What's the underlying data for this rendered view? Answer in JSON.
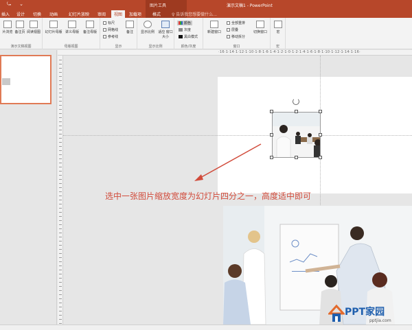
{
  "titlebar": {
    "qat_left": "⤿",
    "qat_mid": "⌄",
    "context_title": "图片工具",
    "doc_title": "演示文稿1 - PowerPoint"
  },
  "tabs": [
    {
      "label": "插入"
    },
    {
      "label": "设计"
    },
    {
      "label": "切换"
    },
    {
      "label": "动画"
    },
    {
      "label": "幻灯片放映"
    },
    {
      "label": "审阅"
    },
    {
      "label": "视图",
      "active": true
    },
    {
      "label": "加载项"
    },
    {
      "label": "格式"
    }
  ],
  "tell_me": "♀ 告诉我您想要做什么...",
  "ribbon": {
    "presentation_views": {
      "label": "演示文稿视图",
      "buttons": [
        "片浏览",
        "备注页",
        "阅读视图"
      ]
    },
    "master_views": {
      "label": "母版视图",
      "buttons": [
        "幻灯片母版",
        "讲义母版",
        "备注母版"
      ]
    },
    "show": {
      "label": "显示",
      "ruler": "标尺",
      "gridlines": "网格线",
      "guides": "参考线",
      "notes": "备注"
    },
    "zoom": {
      "label": "显示比例",
      "zoom_btn": "显示比例",
      "fit_btn": "适应\n窗口大小"
    },
    "color": {
      "label": "颜色/灰度",
      "color": "颜色",
      "grayscale": "灰度",
      "bw": "黑白模式"
    },
    "window": {
      "label": "窗口",
      "new_window": "新建窗口",
      "arrange_all": "全部重排",
      "cascade": "层叠",
      "move_split": "移动拆分",
      "switch": "切换窗口"
    },
    "macros": {
      "label": "宏",
      "btn": "宏"
    }
  },
  "ruler_numbers": "·16·1·14·1·12·1·10·1·8·1·6·1·4·1·2·1·0·1·2·1·4·1·6·1·8·1·10·1·12·1·14·1·16·",
  "annotation": "选中一张图片缩放宽度为幻灯片四分之一，高度适中即可",
  "watermark": {
    "brand": "PPT家园",
    "url": "pptjia.com"
  },
  "colors": {
    "accent": "#b7472a",
    "annotation": "#d14b3b",
    "thumb_border": "#e07a55"
  }
}
